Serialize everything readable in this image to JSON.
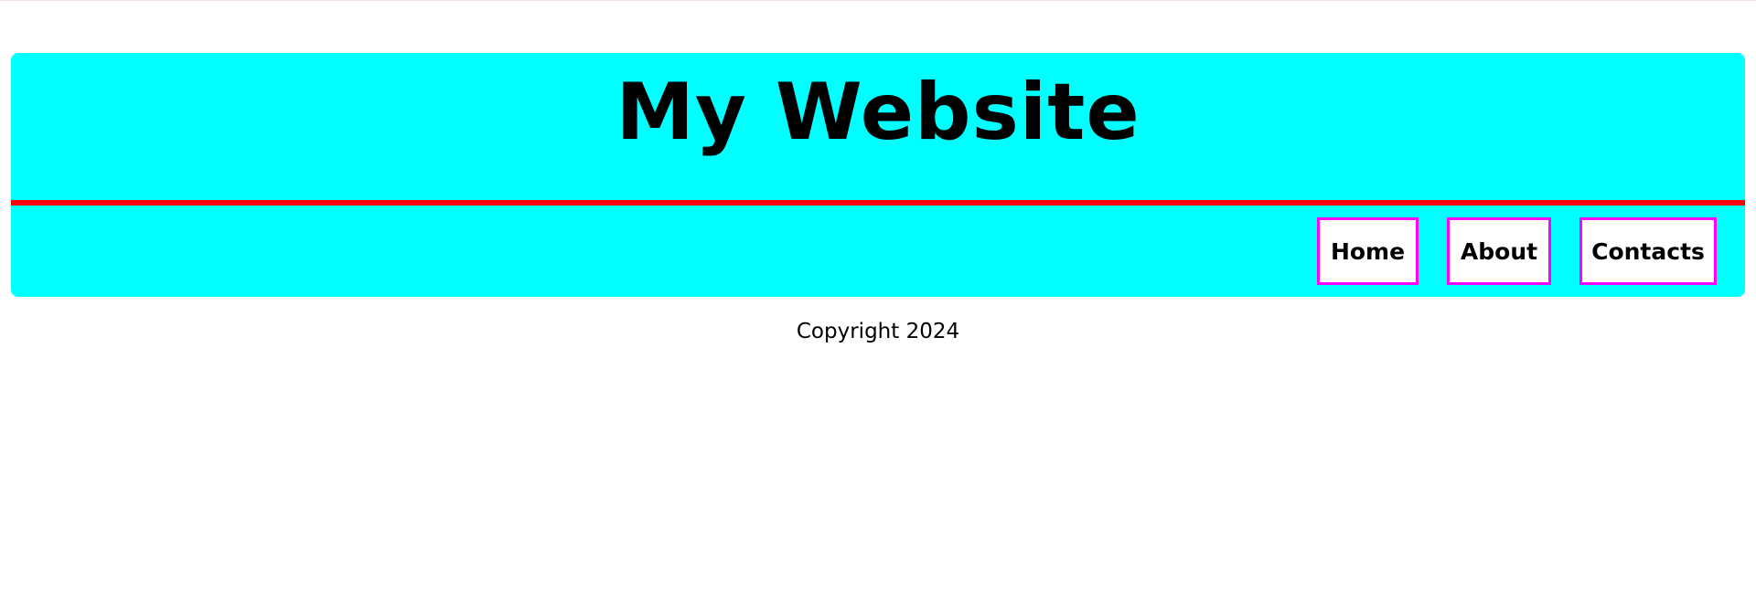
{
  "header": {
    "title": "My Website"
  },
  "nav": {
    "items": [
      {
        "label": "Home"
      },
      {
        "label": "About"
      },
      {
        "label": "Contacts"
      }
    ]
  },
  "footer": {
    "text": "Copyright 2024"
  },
  "colors": {
    "header_background": "#00ffff",
    "divider": "#ff0000",
    "nav_border": "#ff00ff",
    "nav_background": "#ffffff",
    "text": "#000000"
  }
}
